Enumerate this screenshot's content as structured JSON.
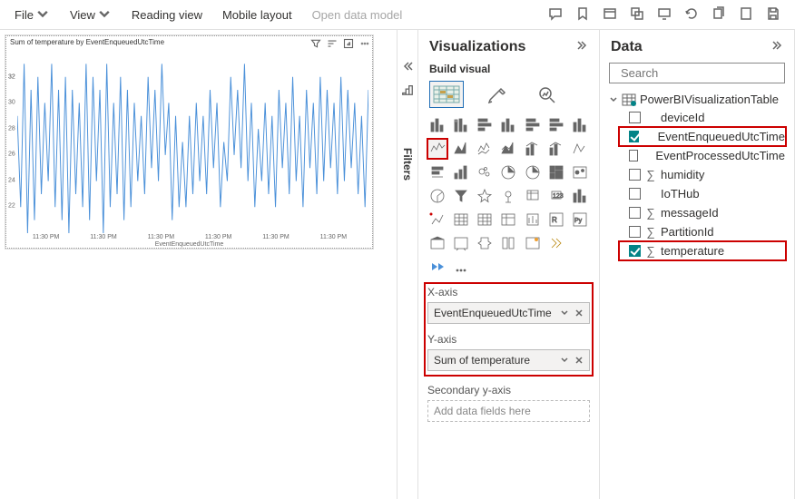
{
  "ribbon": {
    "file": "File",
    "view": "View",
    "reading": "Reading view",
    "mobile": "Mobile layout",
    "open_model": "Open data model"
  },
  "filters": {
    "label": "Filters"
  },
  "viz": {
    "title": "Visualizations",
    "build": "Build visual",
    "wells": {
      "x_label": "X-axis",
      "x_field": "EventEnqueuedUtcTime",
      "y_label": "Y-axis",
      "y_field": "Sum of temperature",
      "secy_label": "Secondary y-axis",
      "secy_ph": "Add data fields here"
    }
  },
  "data": {
    "title": "Data",
    "search_ph": "Search",
    "table": "PowerBIVisualizationTable",
    "fields": [
      {
        "name": "deviceId",
        "checked": false,
        "agg": false,
        "hl": false
      },
      {
        "name": "EventEnqueuedUtcTime",
        "checked": true,
        "agg": false,
        "hl": true
      },
      {
        "name": "EventProcessedUtcTime",
        "checked": false,
        "agg": false,
        "hl": false
      },
      {
        "name": "humidity",
        "checked": false,
        "agg": true,
        "hl": false
      },
      {
        "name": "IoTHub",
        "checked": false,
        "agg": false,
        "hl": false
      },
      {
        "name": "messageId",
        "checked": false,
        "agg": true,
        "hl": false
      },
      {
        "name": "PartitionId",
        "checked": false,
        "agg": true,
        "hl": false
      },
      {
        "name": "temperature",
        "checked": true,
        "agg": true,
        "hl": true
      }
    ]
  },
  "visual": {
    "title": "Sum of temperature by EventEnqueuedUtcTime",
    "xlabel": "EventEnqueuedUtcTime",
    "yticks": [
      "22",
      "24",
      "26",
      "28",
      "30",
      "32",
      "32"
    ],
    "xticks": [
      "11:30 PM",
      "11:30 PM",
      "11:30 PM",
      "11:30 PM",
      "11:30 PM",
      "11:30 PM"
    ]
  },
  "chart_data": {
    "type": "line",
    "title": "Sum of temperature by EventEnqueuedUtcTime",
    "xlabel": "EventEnqueuedUtcTime",
    "ylabel": "Sum of temperature",
    "ylim": [
      20,
      34
    ],
    "series": [
      {
        "name": "Sum of temperature",
        "values": [
          29,
          22,
          33,
          20,
          31,
          21,
          32,
          23,
          30,
          24,
          33,
          22,
          31,
          21,
          32,
          20,
          31,
          23,
          30,
          22,
          33,
          21,
          32,
          24,
          31,
          20,
          33,
          22,
          30,
          23,
          32,
          21,
          31,
          22,
          30,
          24,
          29,
          23,
          32,
          25,
          31,
          24,
          33,
          26,
          30,
          21,
          29,
          22,
          27,
          22,
          29,
          23,
          30,
          24,
          29,
          23,
          31,
          25,
          30,
          22,
          27,
          24,
          32,
          26,
          31,
          25,
          33,
          24,
          30,
          22,
          28,
          24,
          30,
          23,
          29,
          22,
          31,
          25,
          30,
          23,
          32,
          24,
          29,
          22,
          31,
          25,
          30,
          23,
          32,
          24,
          31,
          25,
          30,
          23,
          32,
          24,
          31,
          25,
          30,
          23,
          29,
          22,
          31
        ]
      }
    ]
  }
}
